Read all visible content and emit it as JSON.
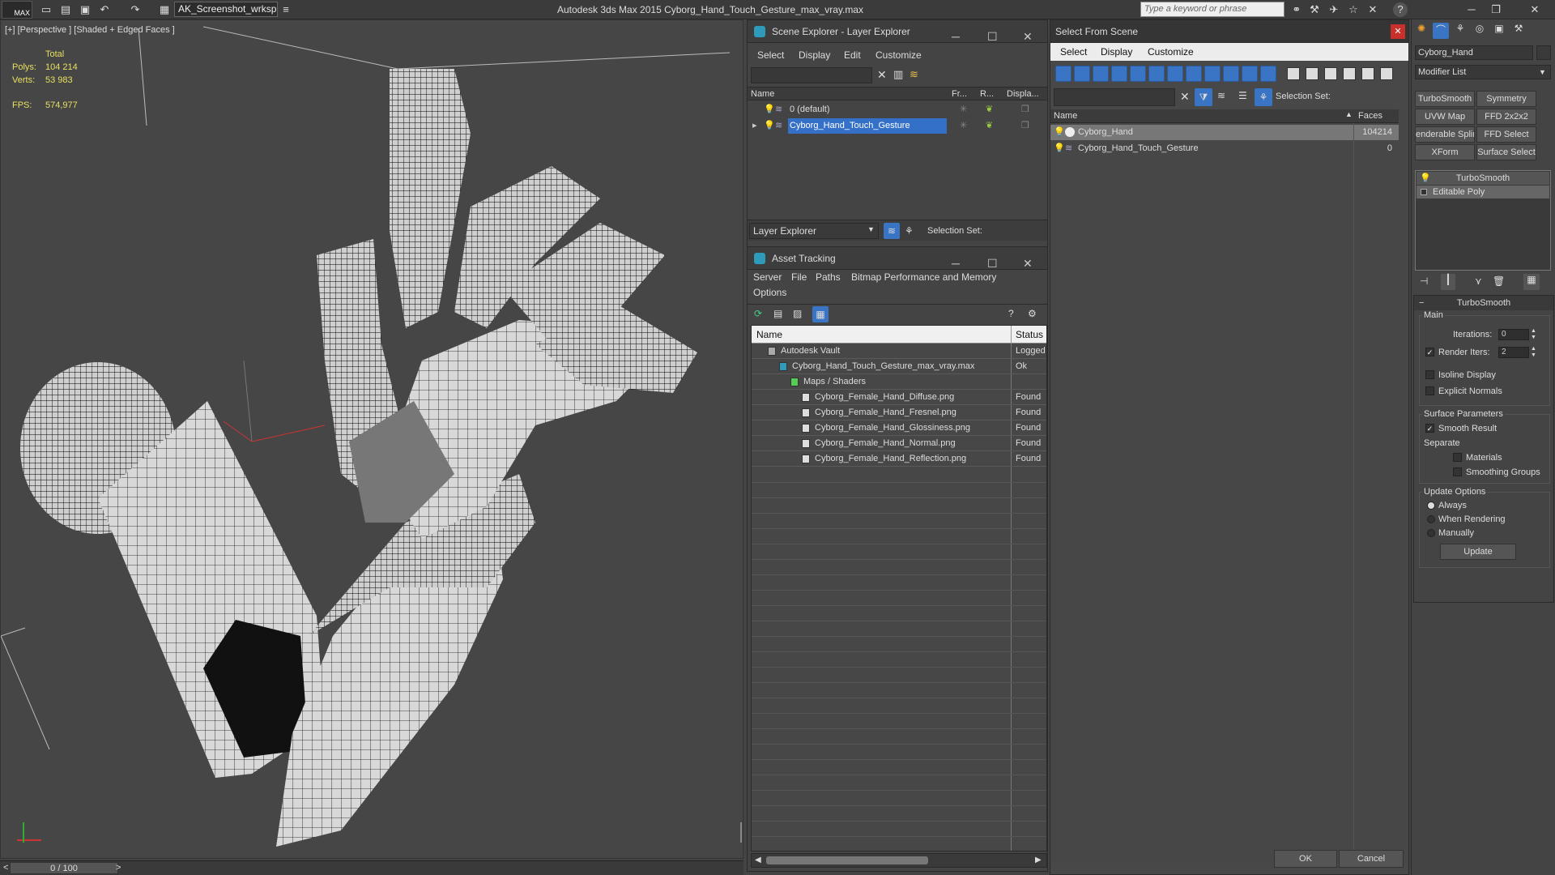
{
  "titlebar": {
    "logo": "MAX",
    "workspace": "AK_Screenshot_wrksp",
    "title": "Autodesk 3ds Max  2015     Cyborg_Hand_Touch_Gesture_max_vray.max",
    "search_placeholder": "Type a keyword or phrase"
  },
  "viewport": {
    "label": "[+] [Perspective ] [Shaded + Edged Faces ]",
    "stats": {
      "total_label": "Total",
      "polys_label": "Polys:",
      "polys_value": "104 214",
      "verts_label": "Verts:",
      "verts_value": "53 983",
      "fps_label": "FPS:",
      "fps_value": "574,977"
    }
  },
  "timeline": {
    "value": "0 / 100",
    "prev": "<",
    "next": ">"
  },
  "scene_explorer": {
    "title": "Scene Explorer - Layer Explorer",
    "menu": [
      "Select",
      "Display",
      "Edit",
      "Customize"
    ],
    "columns": [
      "Name",
      "Fr...",
      "R...",
      "Displa..."
    ],
    "rows": [
      {
        "name": "0 (default)"
      },
      {
        "name": "Cyborg_Hand_Touch_Gesture"
      }
    ],
    "footer_dropdown": "Layer Explorer",
    "selection_set_label": "Selection Set:"
  },
  "asset_tracking": {
    "title": "Asset Tracking",
    "menu": [
      "Server",
      "File",
      "Paths",
      "Bitmap Performance and Memory",
      "Options"
    ],
    "columns": [
      "Name",
      "Status"
    ],
    "rows": [
      {
        "name": "Autodesk Vault",
        "status": "Logged"
      },
      {
        "name": "Cyborg_Hand_Touch_Gesture_max_vray.max",
        "status": "Ok"
      },
      {
        "name": "Maps / Shaders",
        "status": ""
      },
      {
        "name": "Cyborg_Female_Hand_Diffuse.png",
        "status": "Found"
      },
      {
        "name": "Cyborg_Female_Hand_Fresnel.png",
        "status": "Found"
      },
      {
        "name": "Cyborg_Female_Hand_Glossiness.png",
        "status": "Found"
      },
      {
        "name": "Cyborg_Female_Hand_Normal.png",
        "status": "Found"
      },
      {
        "name": "Cyborg_Female_Hand_Reflection.png",
        "status": "Found"
      }
    ]
  },
  "select_from_scene": {
    "title": "Select From Scene",
    "menu": [
      "Select",
      "Display",
      "Customize"
    ],
    "selection_set_label": "Selection Set:",
    "columns": [
      "Name",
      "Faces"
    ],
    "rows": [
      {
        "name": "Cyborg_Hand",
        "faces": "104214"
      },
      {
        "name": "Cyborg_Hand_Touch_Gesture",
        "faces": "0"
      }
    ],
    "ok": "OK",
    "cancel": "Cancel"
  },
  "command_panel": {
    "object_name": "Cyborg_Hand",
    "modifier_list": "Modifier List",
    "mod_buttons": [
      "TurboSmooth",
      "Symmetry",
      "UVW Map",
      "FFD 2x2x2",
      "enderable Splin",
      "FFD Select",
      "XForm",
      "Surface Select"
    ],
    "stack": [
      "TurboSmooth",
      "Editable Poly"
    ],
    "rollout_title": "TurboSmooth",
    "main_label": "Main",
    "iterations_label": "Iterations:",
    "iterations_value": "0",
    "render_iters_label": "Render Iters:",
    "render_iters_value": "2",
    "isoline": "Isoline Display",
    "explicit_normals": "Explicit Normals",
    "surface_params": "Surface Parameters",
    "smooth_result": "Smooth Result",
    "separate": "Separate",
    "materials": "Materials",
    "smoothing_groups": "Smoothing Groups",
    "update_options": "Update Options",
    "always": "Always",
    "when_rendering": "When Rendering",
    "manually": "Manually",
    "update": "Update"
  }
}
